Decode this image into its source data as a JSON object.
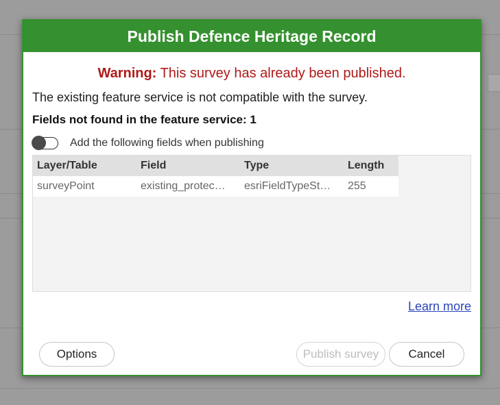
{
  "dialog": {
    "title": "Publish Defence Heritage Record",
    "warning_prefix": "Warning:",
    "warning_text": " This survey has already been published.",
    "message": "The existing feature service is not compatible with the survey.",
    "fields_not_found": "Fields not found in the feature service: 1",
    "toggle_label": "Add the following fields when publishing",
    "toggle_on": false,
    "table": {
      "headers": [
        "Layer/Table",
        "Field",
        "Type",
        "Length"
      ],
      "rows": [
        [
          "surveyPoint",
          "existing_protec…",
          "esriFieldTypeSt…",
          "255"
        ]
      ]
    },
    "learn_more": "Learn more",
    "buttons": {
      "options": "Options",
      "publish": "Publish survey",
      "cancel": "Cancel"
    }
  },
  "colors": {
    "header_green": "#35912f",
    "warning_red": "#b01818",
    "link_blue": "#2a45b8"
  }
}
